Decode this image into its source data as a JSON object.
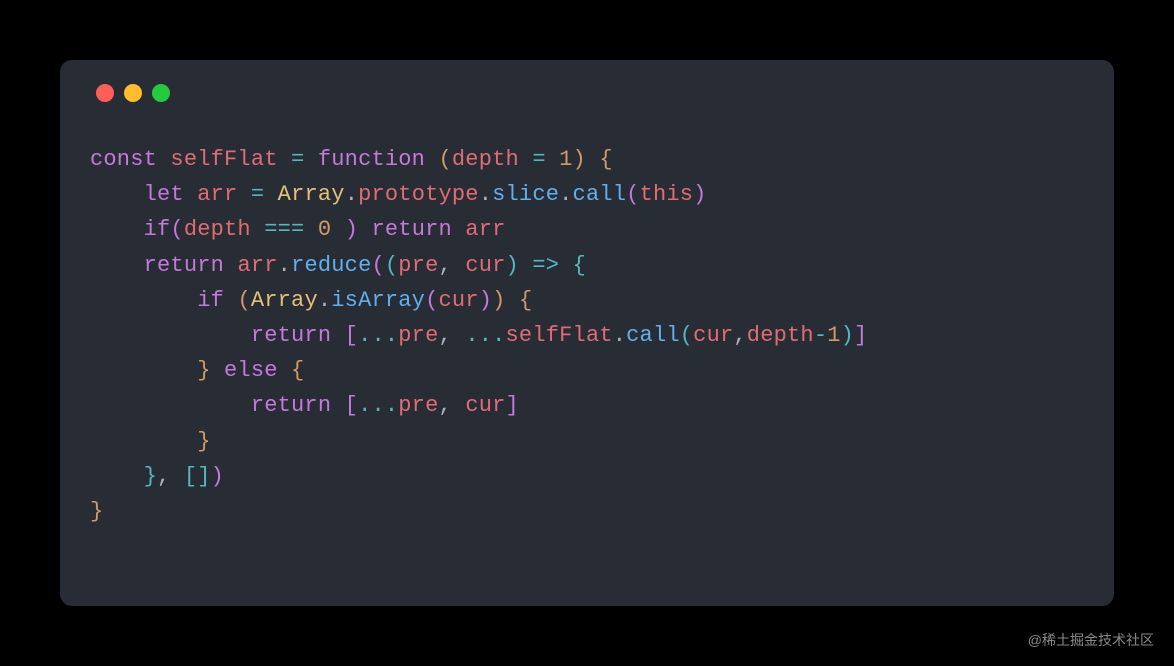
{
  "watermark": "@稀土掘金技术社区",
  "code": {
    "tokens": [
      [
        {
          "t": "const",
          "c": "kw"
        },
        {
          "t": " ",
          "c": "punct"
        },
        {
          "t": "selfFlat",
          "c": "ident"
        },
        {
          "t": " ",
          "c": "punct"
        },
        {
          "t": "=",
          "c": "op"
        },
        {
          "t": " ",
          "c": "punct"
        },
        {
          "t": "function",
          "c": "kw"
        },
        {
          "t": " ",
          "c": "punct"
        },
        {
          "t": "(",
          "c": "punct2"
        },
        {
          "t": "depth",
          "c": "ident"
        },
        {
          "t": " ",
          "c": "punct"
        },
        {
          "t": "=",
          "c": "op"
        },
        {
          "t": " ",
          "c": "punct"
        },
        {
          "t": "1",
          "c": "num"
        },
        {
          "t": ")",
          "c": "punct2"
        },
        {
          "t": " ",
          "c": "punct"
        },
        {
          "t": "{",
          "c": "punct2"
        }
      ],
      [
        {
          "t": "    ",
          "c": "punct"
        },
        {
          "t": "let",
          "c": "kw"
        },
        {
          "t": " ",
          "c": "punct"
        },
        {
          "t": "arr",
          "c": "ident"
        },
        {
          "t": " ",
          "c": "punct"
        },
        {
          "t": "=",
          "c": "op"
        },
        {
          "t": " ",
          "c": "punct"
        },
        {
          "t": "Array",
          "c": "builtin"
        },
        {
          "t": ".",
          "c": "punct"
        },
        {
          "t": "prototype",
          "c": "prop"
        },
        {
          "t": ".",
          "c": "punct"
        },
        {
          "t": "slice",
          "c": "method"
        },
        {
          "t": ".",
          "c": "punct"
        },
        {
          "t": "call",
          "c": "method"
        },
        {
          "t": "(",
          "c": "punct3"
        },
        {
          "t": "this",
          "c": "ident"
        },
        {
          "t": ")",
          "c": "punct3"
        }
      ],
      [
        {
          "t": "    ",
          "c": "punct"
        },
        {
          "t": "if",
          "c": "kw"
        },
        {
          "t": "(",
          "c": "punct3"
        },
        {
          "t": "depth",
          "c": "ident"
        },
        {
          "t": " ",
          "c": "punct"
        },
        {
          "t": "===",
          "c": "op"
        },
        {
          "t": " ",
          "c": "punct"
        },
        {
          "t": "0",
          "c": "num"
        },
        {
          "t": " ",
          "c": "punct"
        },
        {
          "t": ")",
          "c": "punct3"
        },
        {
          "t": " ",
          "c": "punct"
        },
        {
          "t": "return",
          "c": "kw"
        },
        {
          "t": " ",
          "c": "punct"
        },
        {
          "t": "arr",
          "c": "ident"
        }
      ],
      [
        {
          "t": "    ",
          "c": "punct"
        },
        {
          "t": "return",
          "c": "kw"
        },
        {
          "t": " ",
          "c": "punct"
        },
        {
          "t": "arr",
          "c": "ident"
        },
        {
          "t": ".",
          "c": "punct"
        },
        {
          "t": "reduce",
          "c": "method"
        },
        {
          "t": "(",
          "c": "punct3"
        },
        {
          "t": "(",
          "c": "punct4"
        },
        {
          "t": "pre",
          "c": "ident"
        },
        {
          "t": ",",
          "c": "punct"
        },
        {
          "t": " ",
          "c": "punct"
        },
        {
          "t": "cur",
          "c": "ident"
        },
        {
          "t": ")",
          "c": "punct4"
        },
        {
          "t": " ",
          "c": "punct"
        },
        {
          "t": "=>",
          "c": "op"
        },
        {
          "t": " ",
          "c": "punct"
        },
        {
          "t": "{",
          "c": "punct4"
        }
      ],
      [
        {
          "t": "        ",
          "c": "punct"
        },
        {
          "t": "if",
          "c": "kw"
        },
        {
          "t": " ",
          "c": "punct"
        },
        {
          "t": "(",
          "c": "punct2"
        },
        {
          "t": "Array",
          "c": "builtin"
        },
        {
          "t": ".",
          "c": "punct"
        },
        {
          "t": "isArray",
          "c": "method"
        },
        {
          "t": "(",
          "c": "punct3"
        },
        {
          "t": "cur",
          "c": "ident"
        },
        {
          "t": ")",
          "c": "punct3"
        },
        {
          "t": ")",
          "c": "punct2"
        },
        {
          "t": " ",
          "c": "punct"
        },
        {
          "t": "{",
          "c": "punct2"
        }
      ],
      [
        {
          "t": "            ",
          "c": "punct"
        },
        {
          "t": "return",
          "c": "kw"
        },
        {
          "t": " ",
          "c": "punct"
        },
        {
          "t": "[",
          "c": "punct3"
        },
        {
          "t": "...",
          "c": "op"
        },
        {
          "t": "pre",
          "c": "ident"
        },
        {
          "t": ",",
          "c": "punct"
        },
        {
          "t": " ",
          "c": "punct"
        },
        {
          "t": "...",
          "c": "op"
        },
        {
          "t": "selfFlat",
          "c": "ident"
        },
        {
          "t": ".",
          "c": "punct"
        },
        {
          "t": "call",
          "c": "method"
        },
        {
          "t": "(",
          "c": "punct4"
        },
        {
          "t": "cur",
          "c": "ident"
        },
        {
          "t": ",",
          "c": "punct"
        },
        {
          "t": "depth",
          "c": "ident"
        },
        {
          "t": "-",
          "c": "op"
        },
        {
          "t": "1",
          "c": "num"
        },
        {
          "t": ")",
          "c": "punct4"
        },
        {
          "t": "]",
          "c": "punct3"
        }
      ],
      [
        {
          "t": "        ",
          "c": "punct"
        },
        {
          "t": "}",
          "c": "punct2"
        },
        {
          "t": " ",
          "c": "punct"
        },
        {
          "t": "else",
          "c": "kw"
        },
        {
          "t": " ",
          "c": "punct"
        },
        {
          "t": "{",
          "c": "punct2"
        }
      ],
      [
        {
          "t": "            ",
          "c": "punct"
        },
        {
          "t": "return",
          "c": "kw"
        },
        {
          "t": " ",
          "c": "punct"
        },
        {
          "t": "[",
          "c": "punct3"
        },
        {
          "t": "...",
          "c": "op"
        },
        {
          "t": "pre",
          "c": "ident"
        },
        {
          "t": ",",
          "c": "punct"
        },
        {
          "t": " ",
          "c": "punct"
        },
        {
          "t": "cur",
          "c": "ident"
        },
        {
          "t": "]",
          "c": "punct3"
        }
      ],
      [
        {
          "t": "        ",
          "c": "punct"
        },
        {
          "t": "}",
          "c": "punct2"
        }
      ],
      [
        {
          "t": "    ",
          "c": "punct"
        },
        {
          "t": "}",
          "c": "punct4"
        },
        {
          "t": ",",
          "c": "punct"
        },
        {
          "t": " ",
          "c": "punct"
        },
        {
          "t": "[",
          "c": "punct4"
        },
        {
          "t": "]",
          "c": "punct4"
        },
        {
          "t": ")",
          "c": "punct3"
        }
      ],
      [
        {
          "t": "}",
          "c": "punct2"
        }
      ]
    ]
  }
}
